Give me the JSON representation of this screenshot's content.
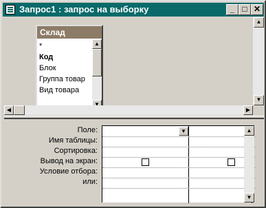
{
  "window": {
    "title": "Запрос1 : запрос на выборку",
    "controls": {
      "minimize": "_",
      "maximize": "□",
      "close": "✕"
    }
  },
  "table": {
    "title": "Склад",
    "fields": [
      {
        "label": "*",
        "bold": false
      },
      {
        "label": "Код",
        "bold": true
      },
      {
        "label": "Блок",
        "bold": false
      },
      {
        "label": "Группа товар",
        "bold": false
      },
      {
        "label": "Вид товара",
        "bold": false
      }
    ]
  },
  "grid": {
    "rows": [
      {
        "label": "Поле:"
      },
      {
        "label": "Имя таблицы:"
      },
      {
        "label": "Сортировка:"
      },
      {
        "label": "Вывод на экран:"
      },
      {
        "label": "Условие отбора:"
      },
      {
        "label": "или:"
      }
    ],
    "columns": [
      {
        "field": "",
        "show": false
      },
      {
        "field": "",
        "show": false
      }
    ]
  },
  "icons": {
    "app": "query-icon",
    "scroll_up": "arrow-up-icon",
    "scroll_down": "arrow-down-icon",
    "scroll_left": "arrow-left-icon",
    "scroll_right": "arrow-right-icon",
    "dropdown": "chevron-down-icon"
  },
  "colors": {
    "titlebar": "#0a6a6a",
    "table_header": "#8c7b67",
    "face": "#d4d0c8"
  }
}
